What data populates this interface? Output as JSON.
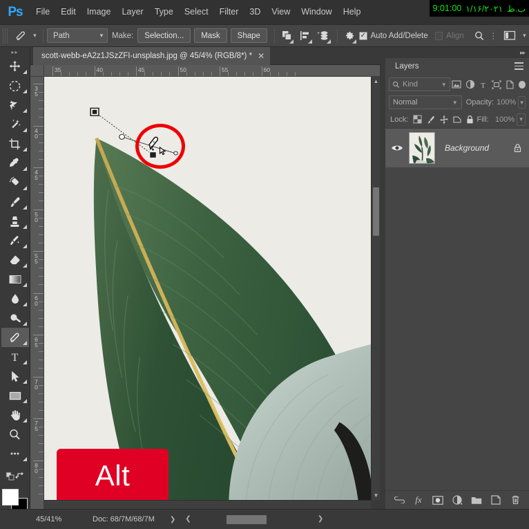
{
  "app": {
    "name": "Ps",
    "logo_text": "Ps"
  },
  "menubar": {
    "items": [
      "File",
      "Edit",
      "Image",
      "Layer",
      "Type",
      "Select",
      "Filter",
      "3D",
      "View",
      "Window",
      "Help"
    ]
  },
  "clock": {
    "time": "9:01:00",
    "date": "١/١۶/٢٠٢١",
    "meridiem": "ب.ظ"
  },
  "options_bar": {
    "tool_icon": "pen-tool-icon",
    "mode_select": {
      "value": "Path"
    },
    "make_label": "Make:",
    "selection_button": "Selection...",
    "mask_button": "Mask",
    "shape_button": "Shape",
    "path_operations_icon": "path-operations-icon",
    "path_alignment_icon": "path-alignment-icon",
    "path_arrangement_icon": "path-arrangement-icon",
    "gear_icon": "gear-icon",
    "auto_add_delete": {
      "label": "Auto Add/Delete",
      "checked": true
    },
    "align": {
      "label": "Align",
      "checked": false,
      "disabled": true
    },
    "search_icon": "search-icon",
    "workspace_icon": "workspace-icon"
  },
  "toolbar": {
    "tools": [
      {
        "name": "move-tool",
        "icon": "move-icon",
        "active": false,
        "has_flyout": true
      },
      {
        "name": "elliptical-marquee-tool",
        "icon": "ellipse-marquee-icon",
        "active": false,
        "has_flyout": true
      },
      {
        "name": "lasso-tool",
        "icon": "lasso-icon",
        "active": false,
        "has_flyout": true
      },
      {
        "name": "magic-wand-tool",
        "icon": "magic-wand-icon",
        "active": false,
        "has_flyout": true
      },
      {
        "name": "crop-tool",
        "icon": "crop-icon",
        "active": false,
        "has_flyout": true
      },
      {
        "name": "eyedropper-tool",
        "icon": "eyedropper-icon",
        "active": false,
        "has_flyout": true
      },
      {
        "name": "spot-healing-brush-tool",
        "icon": "healing-brush-icon",
        "active": false,
        "has_flyout": true
      },
      {
        "name": "brush-tool",
        "icon": "brush-icon",
        "active": false,
        "has_flyout": true
      },
      {
        "name": "clone-stamp-tool",
        "icon": "clone-stamp-icon",
        "active": false,
        "has_flyout": true
      },
      {
        "name": "history-brush-tool",
        "icon": "history-brush-icon",
        "active": false,
        "has_flyout": true
      },
      {
        "name": "eraser-tool",
        "icon": "eraser-icon",
        "active": false,
        "has_flyout": true
      },
      {
        "name": "gradient-tool",
        "icon": "gradient-icon",
        "active": false,
        "has_flyout": true
      },
      {
        "name": "blur-tool",
        "icon": "blur-drop-icon",
        "active": false,
        "has_flyout": true
      },
      {
        "name": "dodge-tool",
        "icon": "dodge-icon",
        "active": false,
        "has_flyout": true
      },
      {
        "name": "pen-tool",
        "icon": "pen-tool-icon",
        "active": true,
        "has_flyout": true
      },
      {
        "name": "type-tool",
        "icon": "type-t-icon",
        "active": false,
        "has_flyout": true
      },
      {
        "name": "path-selection-tool",
        "icon": "path-arrow-icon",
        "active": false,
        "has_flyout": true
      },
      {
        "name": "rectangle-tool",
        "icon": "rectangle-icon",
        "active": false,
        "has_flyout": true
      },
      {
        "name": "hand-tool",
        "icon": "hand-icon",
        "active": false,
        "has_flyout": true
      },
      {
        "name": "zoom-tool",
        "icon": "zoom-magnifier-icon",
        "active": false,
        "has_flyout": false
      },
      {
        "name": "edit-toolbar",
        "icon": "ellipsis-icon",
        "active": false,
        "has_flyout": true
      }
    ],
    "foreground_color": "#ffffff",
    "background_color": "#000000",
    "quick_mask_icon": "quick-mask-icon"
  },
  "document_tab": {
    "title": "scott-webb-eA2z1JSzZFI-unsplash.jpg @ 45/4% (RGB/8*) *",
    "close_icon": "close-icon"
  },
  "rulers": {
    "horizontal_labels": [
      "35",
      "40",
      "45",
      "50",
      "55",
      "60"
    ],
    "vertical_labels": [
      "35",
      "40",
      "45",
      "50",
      "55",
      "60",
      "65",
      "70",
      "75",
      "80"
    ],
    "unit": "cm"
  },
  "canvas": {
    "alt_badge": "Alt",
    "annotation": "red-circle-highlight",
    "path_anchor_points": 2
  },
  "layers_panel": {
    "tab_label": "Layers",
    "menu_icon": "panel-menu-icon",
    "filter": {
      "kind_label": "Kind",
      "search_icon": "search-icon",
      "filter_icons": [
        "pixel-layer-filter-icon",
        "adjustment-layer-filter-icon",
        "type-layer-filter-icon",
        "shape-layer-filter-icon",
        "smart-object-filter-icon"
      ],
      "toggle_icon": "filter-toggle-icon"
    },
    "blend_mode": "Normal",
    "opacity_label": "Opacity:",
    "opacity_value": "100%",
    "lock_label": "Lock:",
    "lock_icons": [
      "lock-transparent-pixels-icon",
      "lock-image-pixels-icon",
      "lock-position-icon",
      "lock-artboard-nesting-icon",
      "lock-all-icon"
    ],
    "fill_label": "Fill:",
    "fill_value": "100%",
    "layers": [
      {
        "name": "Background",
        "visible": true,
        "locked": true,
        "thumbnail": "plant-photo-thumbnail"
      }
    ],
    "footer_icons": [
      "link-layers-icon",
      "layer-style-fx-icon",
      "add-layer-mask-icon",
      "new-adjustment-layer-icon",
      "new-group-icon",
      "new-layer-icon",
      "delete-layer-icon"
    ]
  },
  "status_bar": {
    "zoom_level": "45/41%",
    "doc_info": "Doc: 68/7M/68/7M",
    "expand_icon": "chevron-right-icon"
  }
}
